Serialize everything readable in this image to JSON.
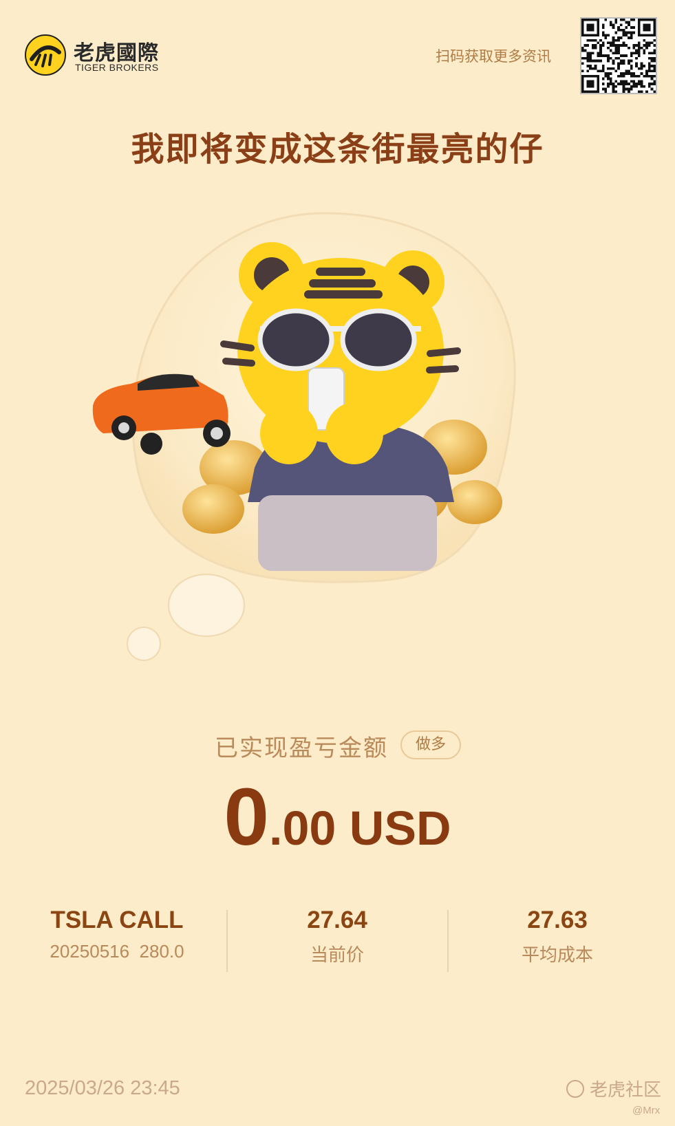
{
  "brand": {
    "name_cn": "老虎國際",
    "name_en": "TIGER BROKERS"
  },
  "header": {
    "scan_text": "扫码获取更多资讯"
  },
  "headline": "我即将变成这条街最亮的仔",
  "pnl": {
    "label": "已实现盈亏金额",
    "direction_badge": "做多",
    "value_int": "0",
    "value_rest": ".00 USD"
  },
  "stats": {
    "contract": {
      "name": "TSLA CALL",
      "detail": "20250516  280.0"
    },
    "current_price": {
      "value": "27.64",
      "label": "当前价"
    },
    "avg_cost": {
      "value": "27.63",
      "label": "平均成本"
    }
  },
  "footer": {
    "timestamp": "2025/03/26 23:45",
    "community": "老虎社区",
    "watermark": "@Mrx"
  },
  "colors": {
    "background": "#fcecc9",
    "headline": "#8b3f17",
    "value": "#8a3a10",
    "tiger_yellow": "#ffd21f",
    "car_orange": "#f06a1e"
  },
  "icons": [
    "tiger-logo-icon",
    "qr-code",
    "community-icon"
  ]
}
